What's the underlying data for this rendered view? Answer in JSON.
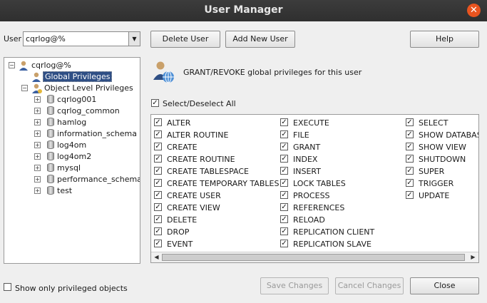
{
  "window": {
    "title": "User Manager",
    "close_glyph": "✕"
  },
  "toolbar": {
    "user_label": "User",
    "user_value": "cqrlog@%",
    "delete_user": "Delete User",
    "add_new_user": "Add New User",
    "help": "Help"
  },
  "tree": {
    "root": "cqrlog@%",
    "global": "Global Privileges",
    "object_level": "Object Level Privileges",
    "databases": [
      "cqrlog001",
      "cqrlog_common",
      "hamlog",
      "information_schema",
      "log4om",
      "log4om2",
      "mysql",
      "performance_schema",
      "test"
    ]
  },
  "description": {
    "text": "GRANT/REVOKE global privileges for this user"
  },
  "select_all": {
    "label": "Select/Deselect All",
    "checked": true
  },
  "privileges": {
    "columns": [
      [
        "ALTER",
        "ALTER ROUTINE",
        "CREATE",
        "CREATE ROUTINE",
        "CREATE TABLESPACE",
        "CREATE TEMPORARY TABLES",
        "CREATE USER",
        "CREATE VIEW",
        "DELETE",
        "DROP",
        "EVENT"
      ],
      [
        "EXECUTE",
        "FILE",
        "GRANT",
        "INDEX",
        "INSERT",
        "LOCK TABLES",
        "PROCESS",
        "REFERENCES",
        "RELOAD",
        "REPLICATION CLIENT",
        "REPLICATION SLAVE"
      ],
      [
        "SELECT",
        "SHOW DATABASES",
        "SHOW VIEW",
        "SHUTDOWN",
        "SUPER",
        "TRIGGER",
        "UPDATE"
      ]
    ],
    "all_checked": true
  },
  "footer": {
    "show_only_label": "Show only privileged objects",
    "save_changes": "Save Changes",
    "cancel_changes": "Cancel Changes",
    "close": "Close"
  },
  "colors": {
    "titlebar": "#2f2f2f",
    "close": "#e9541f",
    "selection": "#2f4f85"
  }
}
